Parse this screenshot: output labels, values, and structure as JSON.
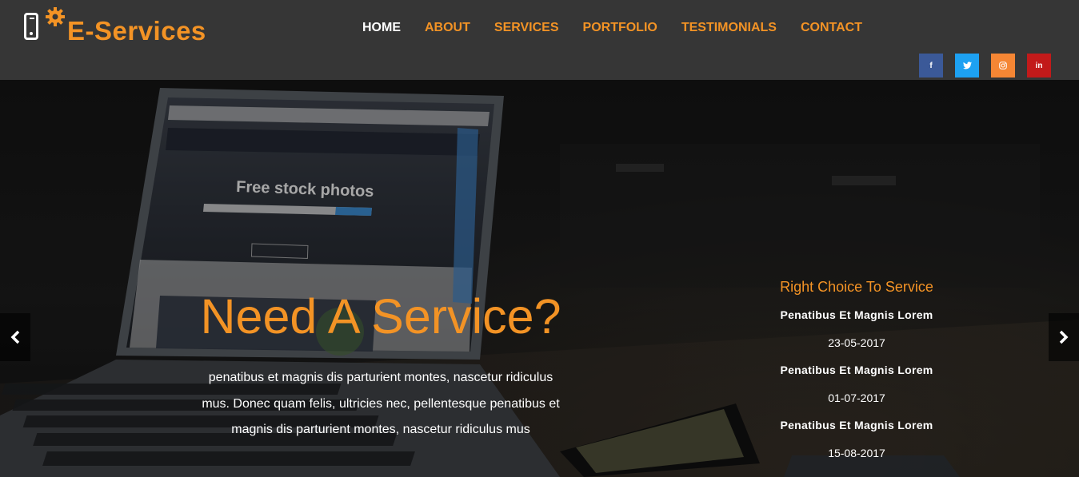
{
  "logo": {
    "text": "E-Services",
    "icon": "phone-gear-icon"
  },
  "nav": {
    "items": [
      {
        "label": "HOME",
        "active": true
      },
      {
        "label": "ABOUT",
        "active": false
      },
      {
        "label": "SERVICES",
        "active": false
      },
      {
        "label": "PORTFOLIO",
        "active": false
      },
      {
        "label": "TESTIMONIALS",
        "active": false
      },
      {
        "label": "CONTACT",
        "active": false
      }
    ]
  },
  "social": [
    {
      "name": "facebook",
      "glyph": "f",
      "color": "#3b5998"
    },
    {
      "name": "twitter",
      "glyph": "t",
      "color": "#1da1f2"
    },
    {
      "name": "instagram",
      "glyph": "◎",
      "color": "#f58634"
    },
    {
      "name": "linkedin",
      "glyph": "in",
      "color": "#c21a1a"
    }
  ],
  "hero": {
    "title": "Need A Service?",
    "description": "penatibus et magnis dis parturient montes, nascetur ridiculus mus. Donec quam felis, ultricies nec, pellentesque penatibus et magnis dis parturient montes, nascetur ridiculus mus",
    "background_texts": {
      "screen_heading": "Free stock photos"
    }
  },
  "sidebar": {
    "title": "Right Choice To Service",
    "items": [
      {
        "title": "Penatibus Et Magnis Lorem",
        "date": "23-05-2017"
      },
      {
        "title": "Penatibus Et Magnis Lorem",
        "date": "01-07-2017"
      },
      {
        "title": "Penatibus Et Magnis Lorem",
        "date": "15-08-2017"
      }
    ]
  },
  "carousel": {
    "prev_icon": "chevron-left-icon",
    "next_icon": "chevron-right-icon"
  },
  "colors": {
    "accent": "#f39325",
    "header_bg": "#363636",
    "active_nav": "#ffffff"
  }
}
